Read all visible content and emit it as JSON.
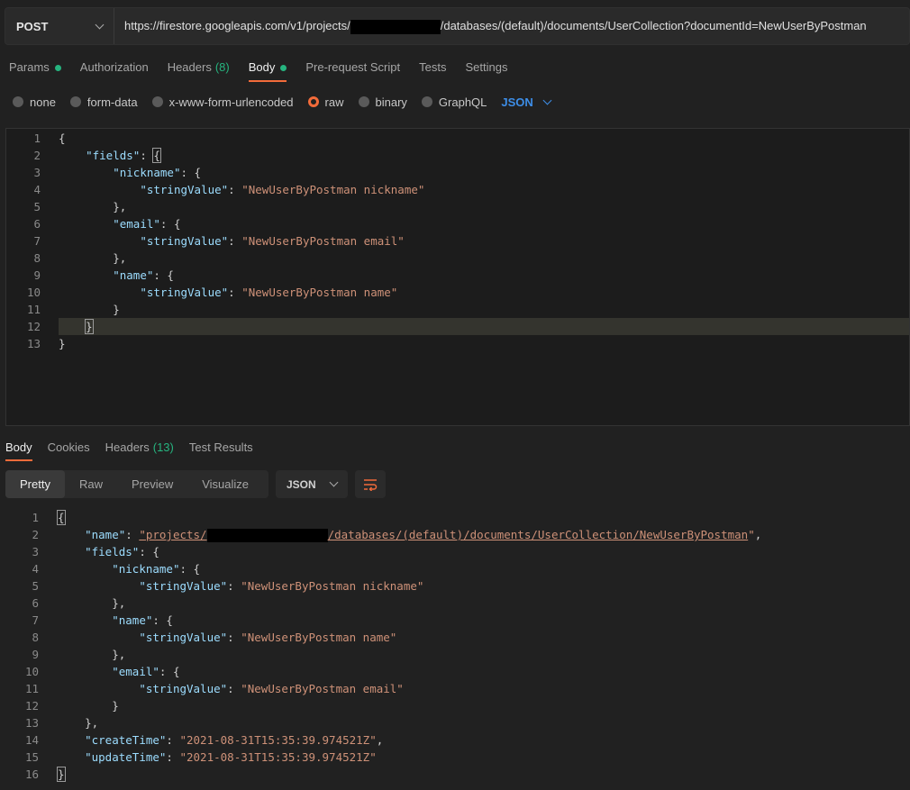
{
  "request": {
    "method": "POST",
    "url_prefix": "https://firestore.googleapis.com/v1/projects/",
    "url_suffix": "/databases/(default)/documents/UserCollection?documentId=NewUserByPostman"
  },
  "req_tabs": {
    "params": "Params",
    "authorization": "Authorization",
    "headers": "Headers",
    "headers_count": "(8)",
    "body": "Body",
    "prerequest": "Pre-request Script",
    "tests": "Tests",
    "settings": "Settings"
  },
  "body_modes": {
    "none": "none",
    "form_data": "form-data",
    "urlencoded": "x-www-form-urlencoded",
    "raw": "raw",
    "binary": "binary",
    "graphql": "GraphQL",
    "format": "JSON"
  },
  "request_body": {
    "line_numbers": [
      "1",
      "2",
      "3",
      "4",
      "5",
      "6",
      "7",
      "8",
      "9",
      "10",
      "11",
      "12",
      "13"
    ],
    "k_fields": "\"fields\"",
    "k_nickname": "\"nickname\"",
    "k_email": "\"email\"",
    "k_name": "\"name\"",
    "k_stringValue": "\"stringValue\"",
    "v_nickname": "\"NewUserByPostman nickname\"",
    "v_email": "\"NewUserByPostman email\"",
    "v_name": "\"NewUserByPostman name\""
  },
  "resp_tabs": {
    "body": "Body",
    "cookies": "Cookies",
    "headers": "Headers",
    "headers_count": "(13)",
    "test_results": "Test Results"
  },
  "view_modes": {
    "pretty": "Pretty",
    "raw": "Raw",
    "preview": "Preview",
    "visualize": "Visualize",
    "format": "JSON"
  },
  "response_body": {
    "line_numbers": [
      "1",
      "2",
      "3",
      "4",
      "5",
      "6",
      "7",
      "8",
      "9",
      "10",
      "11",
      "12",
      "13",
      "14",
      "15",
      "16"
    ],
    "k_name": "\"name\"",
    "name_prefix": "\"projects/",
    "name_suffix": "/databases/(default)/documents/UserCollection/NewUserByPostman",
    "name_end": "\"",
    "k_fields": "\"fields\"",
    "k_nickname": "\"nickname\"",
    "k_name2": "\"name\"",
    "k_email": "\"email\"",
    "k_stringValue": "\"stringValue\"",
    "v_nickname": "\"NewUserByPostman nickname\"",
    "v_name": "\"NewUserByPostman name\"",
    "v_email": "\"NewUserByPostman email\"",
    "k_createTime": "\"createTime\"",
    "v_createTime": "\"2021-08-31T15:35:39.974521Z\"",
    "k_updateTime": "\"updateTime\"",
    "v_updateTime": "\"2021-08-31T15:35:39.974521Z\""
  }
}
